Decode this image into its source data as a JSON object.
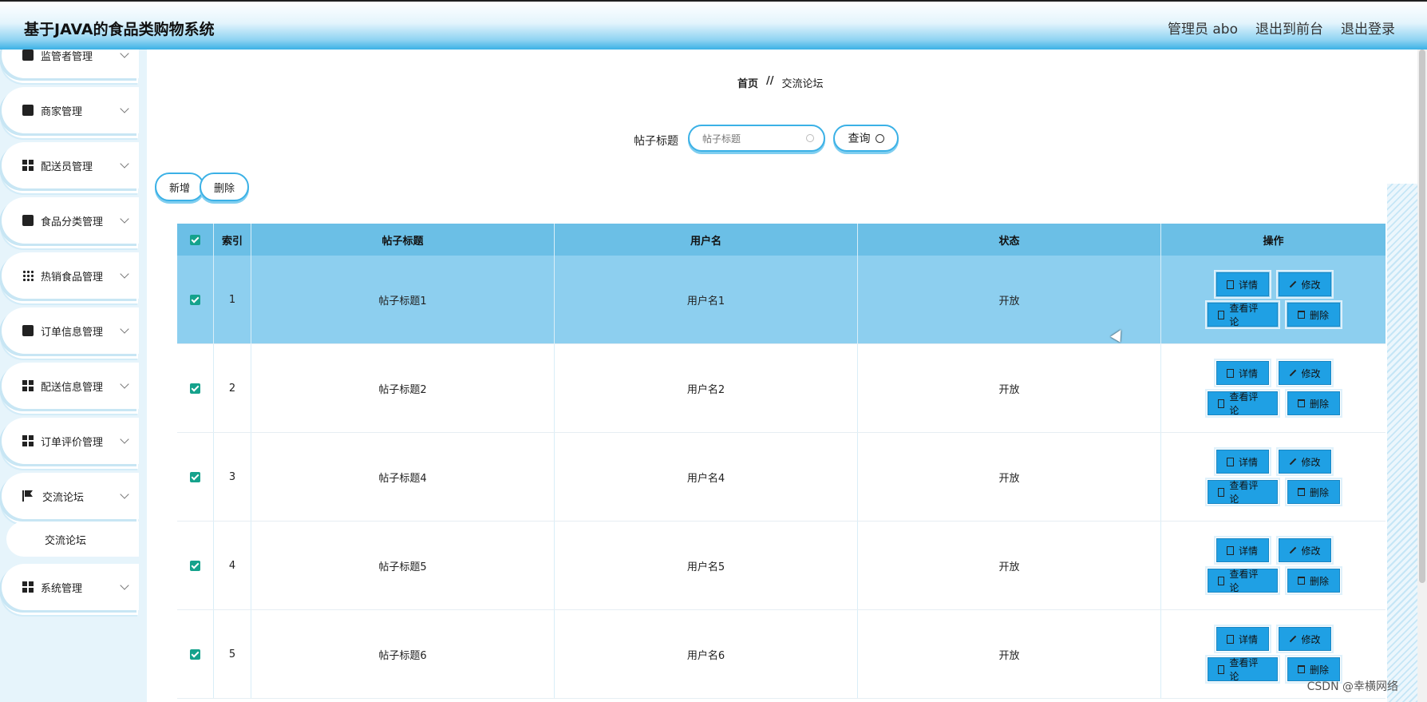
{
  "header": {
    "app_title": "基于JAVA的食品类购物系统",
    "user": "管理员 abo",
    "to_front": "退出到前台",
    "logout": "退出登录"
  },
  "sidebar": {
    "items": [
      {
        "label": "监管者管理",
        "icon": "chart-icon"
      },
      {
        "label": "商家管理",
        "icon": "clipboard-icon"
      },
      {
        "label": "配送员管理",
        "icon": "grid-icon"
      },
      {
        "label": "食品分类管理",
        "icon": "briefcase-icon"
      },
      {
        "label": "热销食品管理",
        "icon": "apps-icon"
      },
      {
        "label": "订单信息管理",
        "icon": "printer-icon"
      },
      {
        "label": "配送信息管理",
        "icon": "grid-icon"
      },
      {
        "label": "订单评价管理",
        "icon": "grid-icon"
      },
      {
        "label": "交流论坛",
        "icon": "flag-icon"
      },
      {
        "label": "系统管理",
        "icon": "grid-icon"
      }
    ],
    "active_sub": "交流论坛"
  },
  "breadcrumb": {
    "home": "首页",
    "sep": "//",
    "current": "交流论坛"
  },
  "search": {
    "label": "帖子标题",
    "placeholder": "帖子标题",
    "query_label": "查询"
  },
  "actions": {
    "add_label": "新增",
    "delete_label": "删除"
  },
  "table": {
    "headers": [
      "索引",
      "帖子标题",
      "用户名",
      "状态",
      "操作"
    ],
    "rows": [
      {
        "index": "1",
        "title": "帖子标题1",
        "user": "用户名1",
        "status": "开放"
      },
      {
        "index": "2",
        "title": "帖子标题2",
        "user": "用户名2",
        "status": "开放"
      },
      {
        "index": "3",
        "title": "帖子标题4",
        "user": "用户名4",
        "status": "开放"
      },
      {
        "index": "4",
        "title": "帖子标题5",
        "user": "用户名5",
        "status": "开放"
      },
      {
        "index": "5",
        "title": "帖子标题6",
        "user": "用户名6",
        "status": "开放"
      }
    ],
    "op_labels": {
      "detail": "详情",
      "edit": "修改",
      "comments": "查看评论",
      "delete": "删除"
    }
  },
  "watermark": "CSDN @幸横网络",
  "colors": {
    "accent": "#1fa0e4",
    "header_row": "#6bbfe6",
    "selected_row": "#8dcfef",
    "checkbox": "#15a28c"
  }
}
